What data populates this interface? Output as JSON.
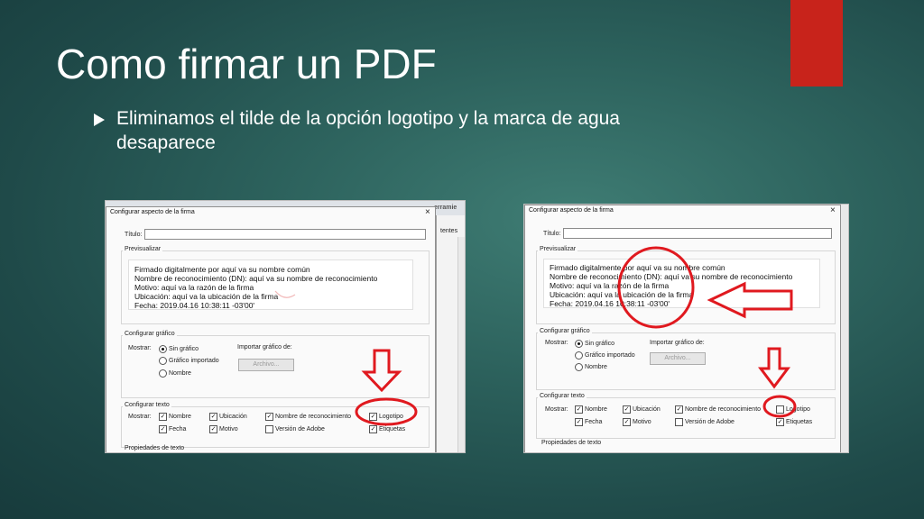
{
  "slide": {
    "title": "Como firmar un PDF",
    "bullet": "Eliminamos el tilde de la opción logotipo y la marca de agua desaparece"
  },
  "colors": {
    "accent": "#c8231b",
    "annotation": "#e0191f"
  },
  "dialog": {
    "title": "Configurar aspecto de la firma",
    "close_icon": "×",
    "title_field_label": "Título:",
    "title_field_value": "",
    "preview_label": "Previsualizar",
    "preview_lines": [
      "Firmado digitalmente por aquí va su nombre común",
      "Nombre de reconocimiento (DN): aquí va su nombre de reconocimiento",
      "Motivo: aquí va la razón de la firma",
      "Ubicación: aquí va la ubicación de la firma",
      "Fecha: 2019.04.16 10:38:11 -03'00'"
    ],
    "graphic_group_label": "Configurar gráfico",
    "show_label": "Mostrar:",
    "graphic_options": [
      "Sin gráfico",
      "Gráfico importado",
      "Nombre"
    ],
    "selected_graphic": "Sin gráfico",
    "import_label": "Importar gráfico de:",
    "file_button": "Archivo...",
    "text_group_label": "Configurar texto",
    "text_show_label": "Mostrar:",
    "text_options": {
      "name": "Nombre",
      "location": "Ubicación",
      "dn": "Nombre de reconocimiento",
      "logo": "Logotipo",
      "date": "Fecha",
      "reason": "Motivo",
      "adobe": "Versión de Adobe",
      "labels": "Etiquetas"
    },
    "text_props_label": "Propiedades de texto"
  },
  "shot1": {
    "background_tool_label": "erramie",
    "background_panel_label": "tentes",
    "checked": {
      "name": true,
      "location": true,
      "dn": true,
      "logo": true,
      "date": true,
      "reason": true,
      "adobe": false,
      "labels": true
    }
  },
  "shot2": {
    "checked": {
      "name": true,
      "location": true,
      "dn": true,
      "logo": false,
      "date": true,
      "reason": true,
      "adobe": false,
      "labels": true
    }
  }
}
